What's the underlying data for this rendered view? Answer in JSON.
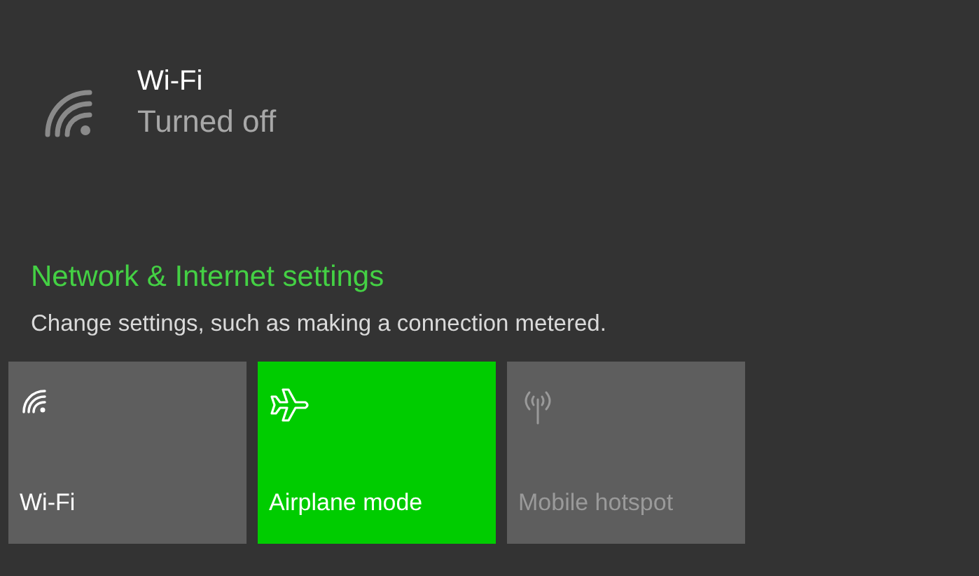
{
  "network": {
    "name": "Wi-Fi",
    "status": "Turned off"
  },
  "settings_link": "Network & Internet settings",
  "description": "Change settings, such as making a connection metered.",
  "quick_actions": [
    {
      "kind": "wifi",
      "label": "Wi-Fi",
      "on": false,
      "disabled": false
    },
    {
      "kind": "airplane",
      "label": "Airplane mode",
      "on": true,
      "disabled": false
    },
    {
      "kind": "hotspot",
      "label": "Mobile hotspot",
      "on": false,
      "disabled": true
    }
  ]
}
